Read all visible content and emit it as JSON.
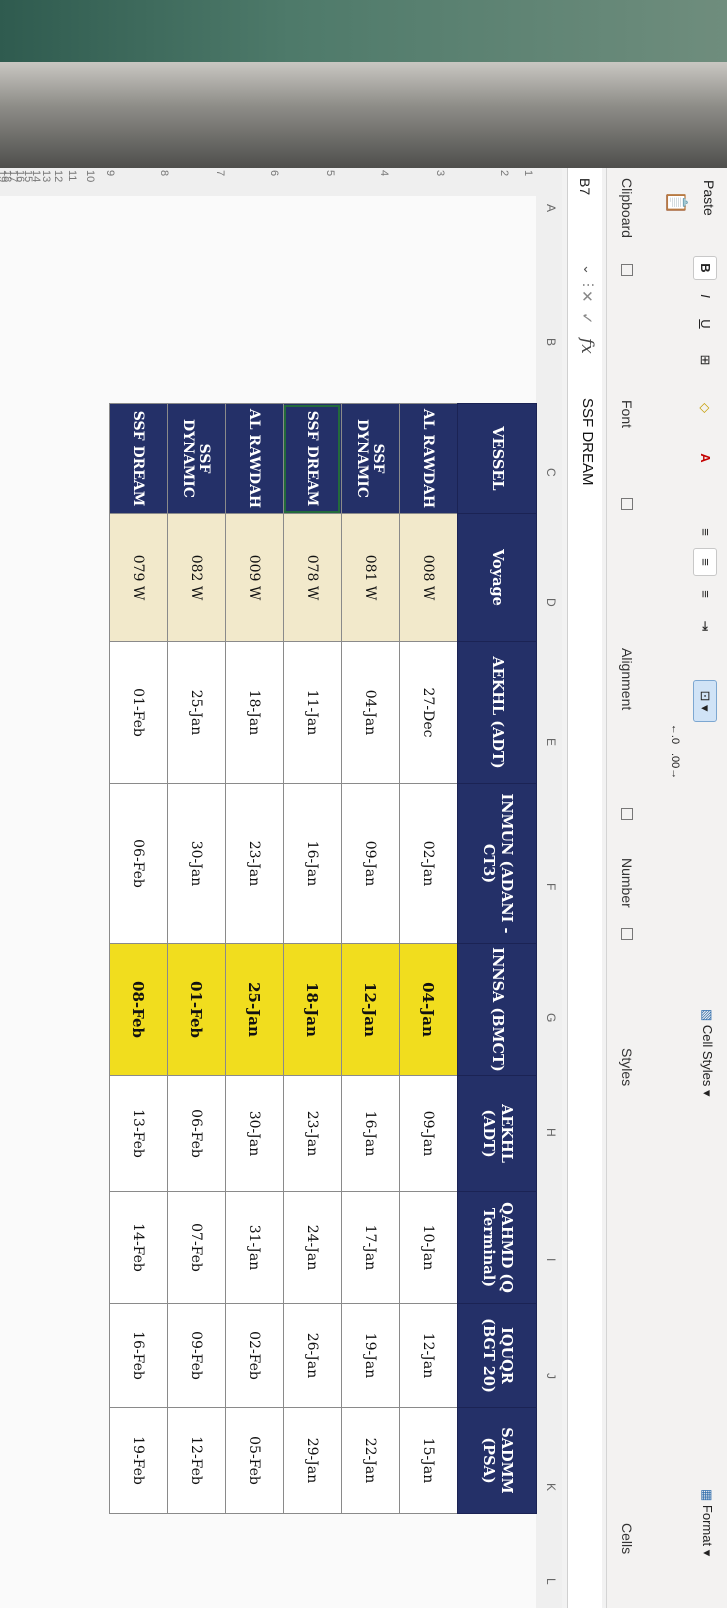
{
  "ribbon": {
    "paste_label": "Paste",
    "clipboard_label": "Clipboard",
    "font_label": "Font",
    "alignment_label": "Alignment",
    "number_label": "Number",
    "styles_label": "Styles",
    "cells_label": "Cells",
    "cell_styles_label": "Cell Styles",
    "format_label": "Format",
    "bold": "B",
    "italic": "I",
    "underline": "U"
  },
  "formula_bar": {
    "name_box": "B7",
    "fx": "fx",
    "value": "SSF DREAM"
  },
  "columns": [
    "A",
    "B",
    "C",
    "D",
    "E",
    "F",
    "G",
    "H",
    "I",
    "J",
    "K",
    "L"
  ],
  "rows": [
    "1",
    "2",
    "3",
    "4",
    "5",
    "6",
    "7",
    "8",
    "9",
    "10",
    "11",
    "12",
    "13",
    "14",
    "15",
    "16",
    "17",
    "18",
    "19"
  ],
  "table": {
    "headers": [
      "VESSEL",
      "Voyage",
      "AEKHL (ADT)",
      "INMUN (ADANI - CT3)",
      "INNSA (BMCT)",
      "AEKHL (ADT)",
      "QAHMD (Q Terminal)",
      "IQUQR (BGT 20)",
      "SADMM (PSA)"
    ],
    "rows": [
      [
        "AL RAWDAH",
        "008 W",
        "27-Dec",
        "02-Jan",
        "04-Jan",
        "09-Jan",
        "10-Jan",
        "12-Jan",
        "15-Jan"
      ],
      [
        "SSF DYNAMIC",
        "081 W",
        "04-Jan",
        "09-Jan",
        "12-Jan",
        "16-Jan",
        "17-Jan",
        "19-Jan",
        "22-Jan"
      ],
      [
        "SSF DREAM",
        "078 W",
        "11-Jan",
        "16-Jan",
        "18-Jan",
        "23-Jan",
        "24-Jan",
        "26-Jan",
        "29-Jan"
      ],
      [
        "AL RAWDAH",
        "009 W",
        "18-Jan",
        "23-Jan",
        "25-Jan",
        "30-Jan",
        "31-Jan",
        "02-Feb",
        "05-Feb"
      ],
      [
        "SSF DYNAMIC",
        "082 W",
        "25-Jan",
        "30-Jan",
        "01-Feb",
        "06-Feb",
        "07-Feb",
        "09-Feb",
        "12-Feb"
      ],
      [
        "SSF DREAM",
        "079 W",
        "01-Feb",
        "06-Feb",
        "08-Feb",
        "13-Feb",
        "14-Feb",
        "16-Feb",
        "19-Feb"
      ]
    ]
  },
  "colors": {
    "header_bg": "#23306b",
    "highlight": "#f3dd14",
    "voyage_bg": "#f2e9c9"
  }
}
